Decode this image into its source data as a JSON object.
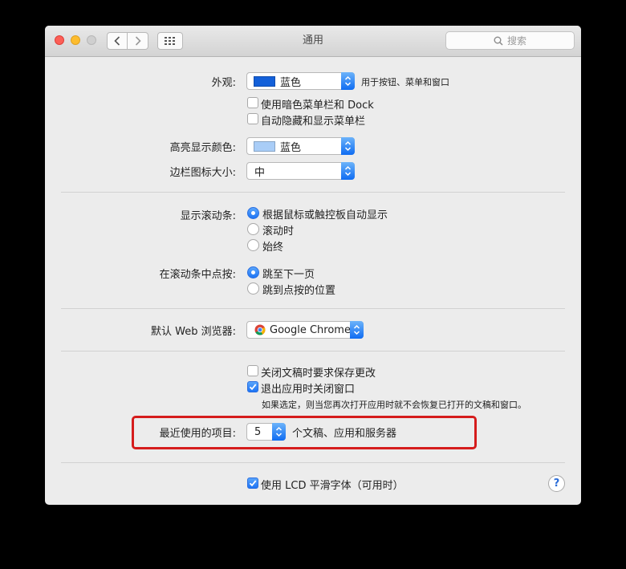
{
  "window": {
    "title": "通用",
    "search_placeholder": "搜索"
  },
  "appearance": {
    "label": "外观:",
    "value": "蓝色",
    "swatch_color": "#1360d9",
    "note": "用于按钮、菜单和窗口"
  },
  "menubar_options": {
    "dark_menubar": "使用暗色菜单栏和 Dock",
    "auto_hide_menubar": "自动隐藏和显示菜单栏"
  },
  "highlight_color": {
    "label": "高亮显示颜色:",
    "value": "蓝色",
    "swatch_color": "#a9cdf7"
  },
  "sidebar_icon_size": {
    "label": "边栏图标大小:",
    "value": "中"
  },
  "show_scrollbars": {
    "label": "显示滚动条:",
    "options": [
      "根据鼠标或触控板自动显示",
      "滚动时",
      "始终"
    ],
    "selected": 0
  },
  "click_scrollbar": {
    "label": "在滚动条中点按:",
    "options": [
      "跳至下一页",
      "跳到点按的位置"
    ],
    "selected": 0
  },
  "default_browser": {
    "label": "默认 Web 浏览器:",
    "value": "Google Chrome"
  },
  "documents": {
    "ask_save": "关闭文稿时要求保存更改",
    "close_windows": "退出应用时关闭窗口",
    "note": "如果选定，则当您再次打开应用时就不会恢复已打开的文稿和窗口。"
  },
  "recent_items": {
    "label": "最近使用的项目:",
    "value": "5",
    "suffix": "个文稿、应用和服务器"
  },
  "lcd_smoothing": {
    "label": "使用 LCD 平滑字体（可用时）"
  },
  "help": {
    "label": "?"
  }
}
